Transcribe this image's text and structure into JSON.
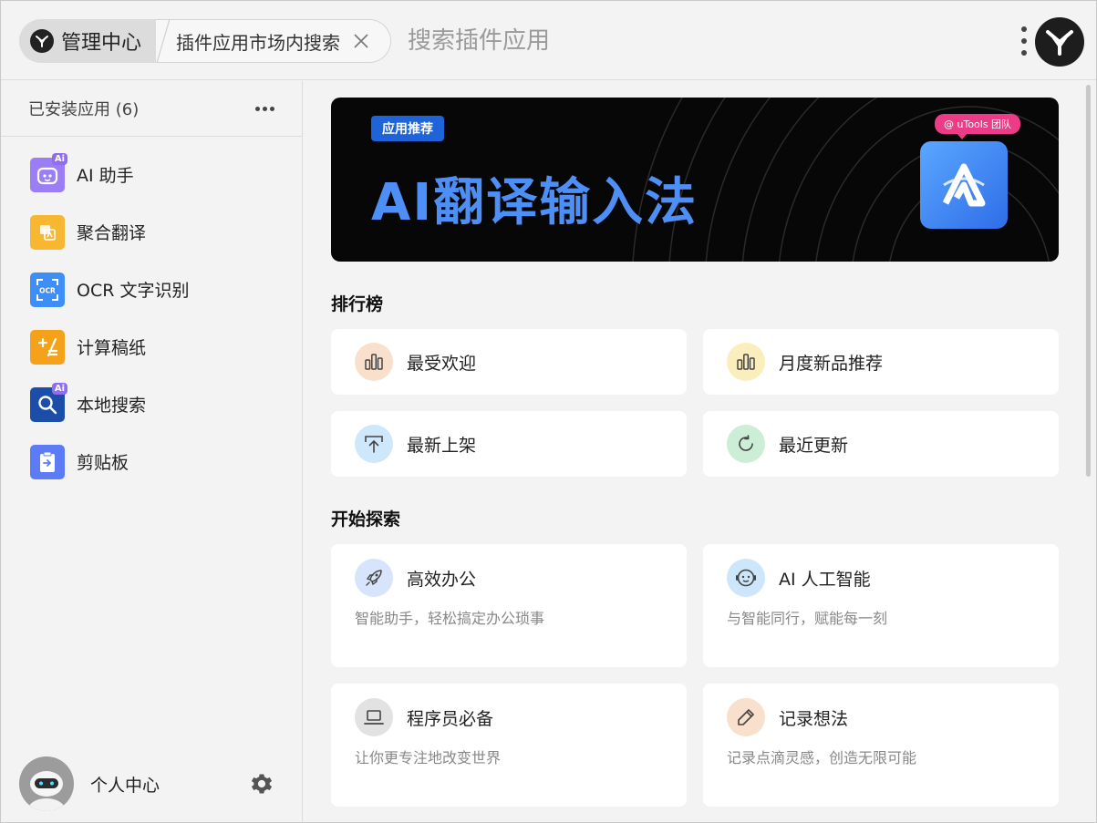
{
  "header": {
    "home_label": "管理中心",
    "plugin_label": "插件应用市场内搜索",
    "search_placeholder": "搜索插件应用"
  },
  "sidebar": {
    "title": "已安装应用 (6)",
    "items": [
      {
        "label": "AI 助手",
        "icon": "robot-icon",
        "color": "#9b7ef5",
        "ai": true
      },
      {
        "label": "聚合翻译",
        "icon": "translate-icon",
        "color": "#f7b731",
        "ai": false
      },
      {
        "label": "OCR 文字识别",
        "icon": "ocr-icon",
        "color": "#3d8ef7",
        "ai": false
      },
      {
        "label": "计算稿纸",
        "icon": "calculator-icon",
        "color": "#f5a21a",
        "ai": false
      },
      {
        "label": "本地搜索",
        "icon": "search-icon",
        "color": "#1c4da8",
        "ai": true
      },
      {
        "label": "剪贴板",
        "icon": "clipboard-icon",
        "color": "#5b7cf6",
        "ai": false
      }
    ],
    "ai_badge": "Ai",
    "profile_label": "个人中心"
  },
  "banner": {
    "tag": "应用推荐",
    "title": "AI翻译输入法",
    "team": "@ uTools 团队"
  },
  "ranking": {
    "title": "排行榜",
    "items": [
      {
        "label": "最受欢迎",
        "icon": "bar-chart-icon",
        "bg": "#f8e0cc"
      },
      {
        "label": "月度新品推荐",
        "icon": "bar-chart-icon",
        "bg": "#fbeebd"
      },
      {
        "label": "最新上架",
        "icon": "upload-icon",
        "bg": "#cfe7fb"
      },
      {
        "label": "最近更新",
        "icon": "refresh-icon",
        "bg": "#cdeed6"
      }
    ]
  },
  "explore": {
    "title": "开始探索",
    "items": [
      {
        "label": "高效办公",
        "desc": "智能助手，轻松搞定办公琐事",
        "icon": "rocket-icon",
        "bg": "#d8e4fb"
      },
      {
        "label": "AI 人工智能",
        "desc": "与智能同行，赋能每一刻",
        "icon": "robot-face-icon",
        "bg": "#cde6fb"
      },
      {
        "label": "程序员必备",
        "desc": "让你更专注地改变世界",
        "icon": "laptop-icon",
        "bg": "#e2e2e2"
      },
      {
        "label": "记录想法",
        "desc": "记录点滴灵感，创造无限可能",
        "icon": "pencil-icon",
        "bg": "#f8e0cc"
      }
    ]
  }
}
